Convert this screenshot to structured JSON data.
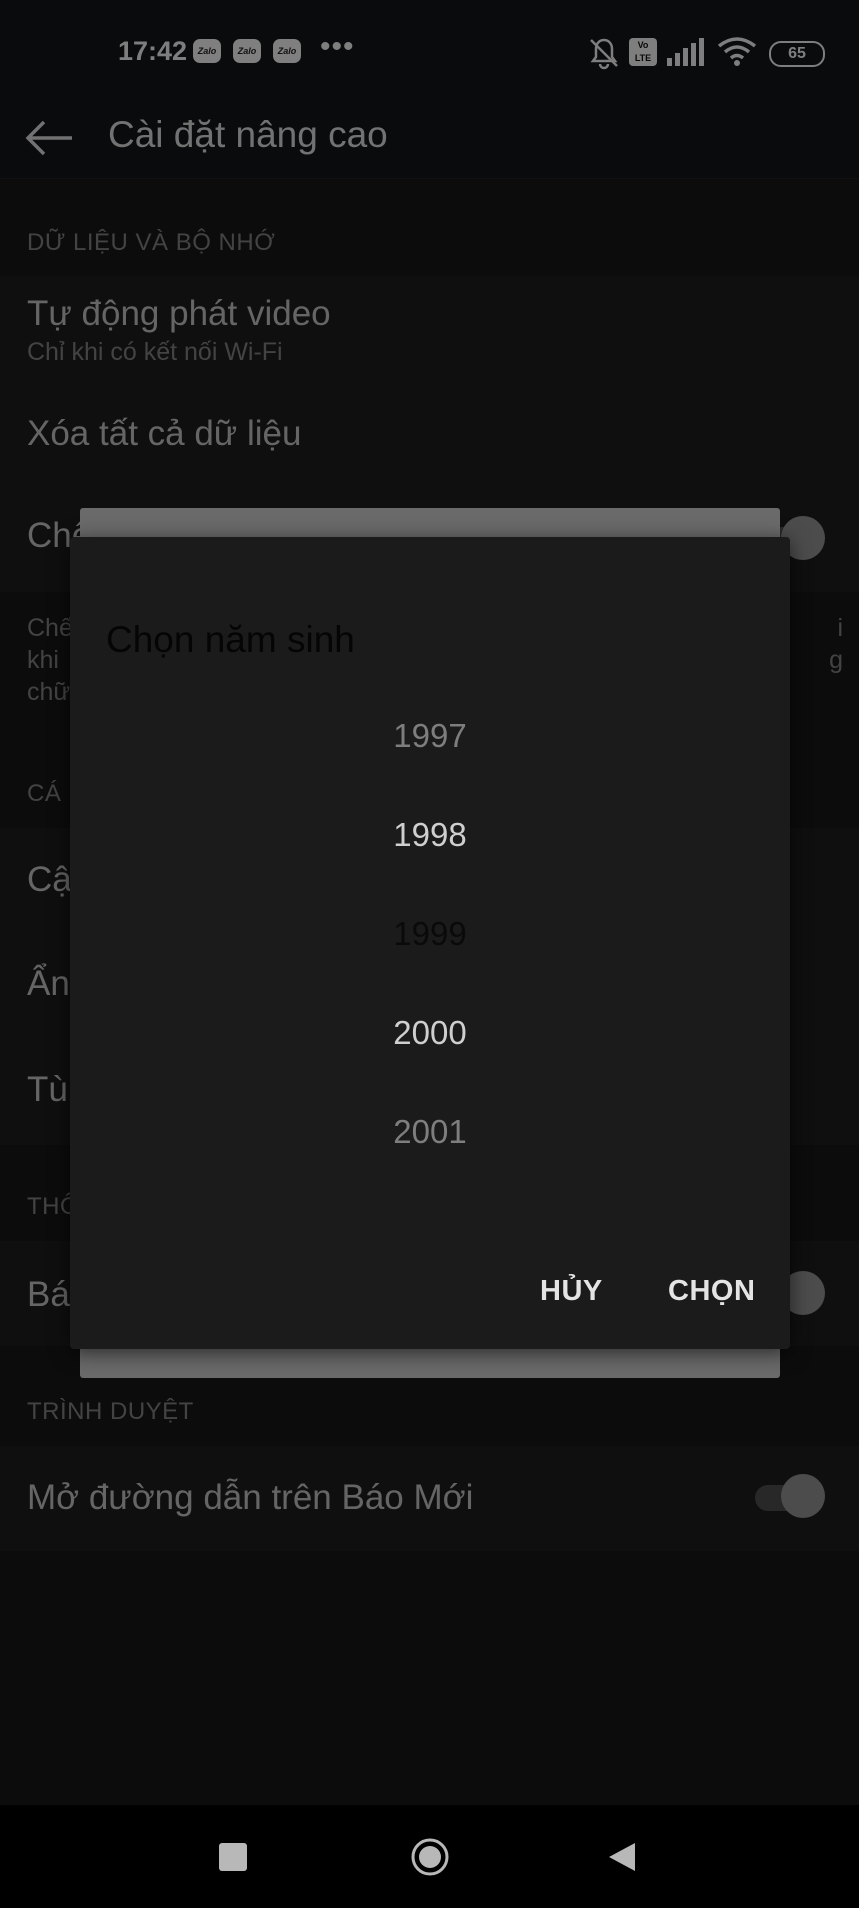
{
  "status_bar": {
    "time": "17:42",
    "notif_icons": [
      "zalo-icon",
      "zalo-icon",
      "zalo-icon"
    ],
    "zalo_text": "Zalo",
    "more": "•••",
    "volte": "Vo LTE",
    "battery": "65"
  },
  "header": {
    "title": "Cài đặt nâng cao"
  },
  "sections": {
    "data_memory": {
      "header": "DỮ LIỆU VÀ BỘ NHỚ",
      "autoplay_title": "Tự động phát video",
      "autoplay_sub": "Chỉ khi có kết nối Wi-Fi",
      "clear_data": "Xóa tất cả dữ liệu",
      "row3_partial": "Chế",
      "desc_lines_left": [
        "Chế",
        "khi",
        "chữ"
      ],
      "desc_lines_right": [
        "i",
        "g"
      ]
    },
    "personal": {
      "header_partial": "CÁ",
      "row1_partial": "Cậ",
      "row2_partial": "Ẩn",
      "row3_partial": "Tù"
    },
    "notify": {
      "header_partial": "THÔ",
      "row1_partial": "Bá"
    },
    "browser": {
      "header": "TRÌNH DUYỆT",
      "open_links": "Mở đường dẫn trên Báo Mới"
    }
  },
  "dialog": {
    "title": "Chọn năm sinh",
    "years": [
      "1997",
      "1998",
      "1999",
      "2000",
      "2001"
    ],
    "cancel_label": "HỦY",
    "choose_label": "CHỌN"
  },
  "colors": {
    "background": "#161616",
    "dialog": "#1b1b1b",
    "accent_text": "#e4e4e4"
  }
}
